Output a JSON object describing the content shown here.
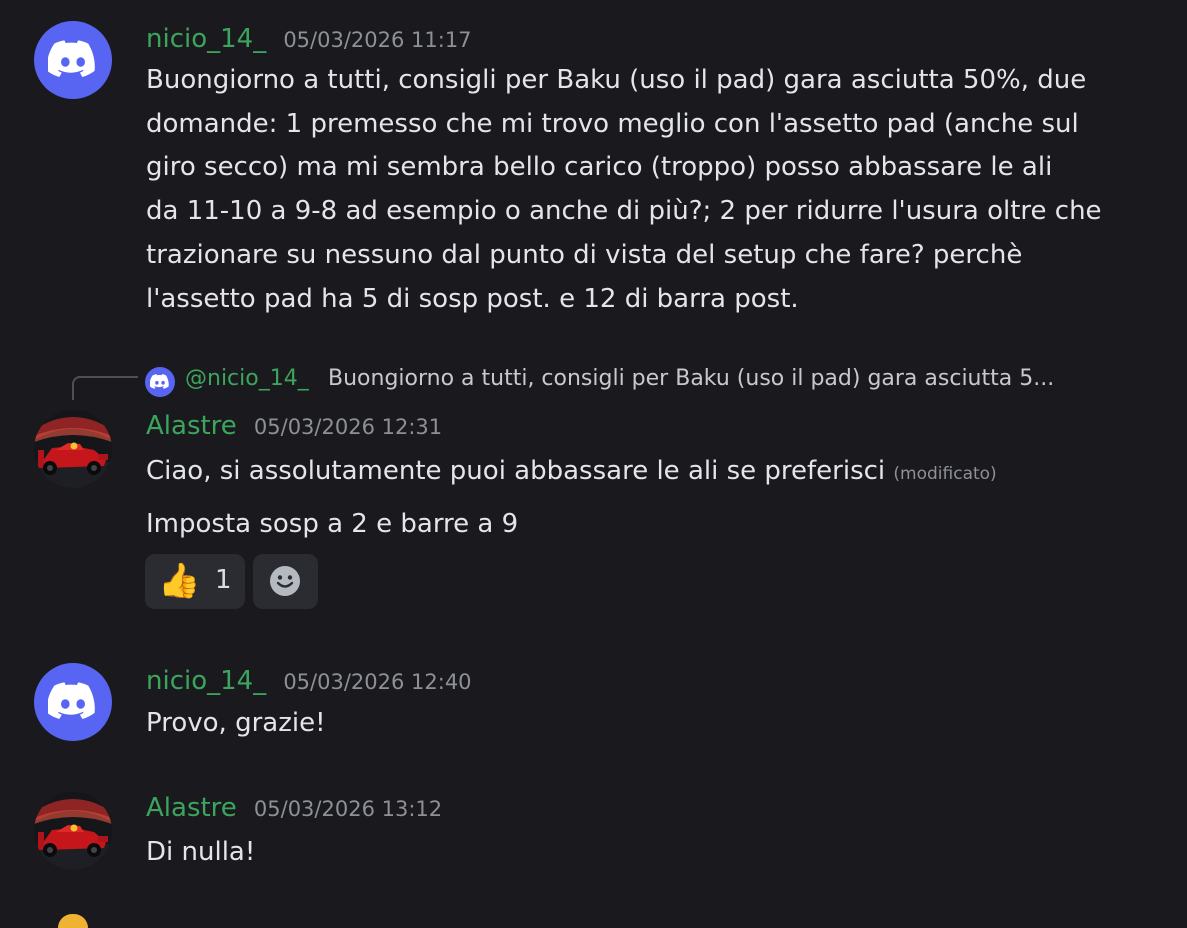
{
  "messages": [
    {
      "username": "nicio_14_",
      "timestamp": "05/03/2026 11:17",
      "avatar_icon": "discord-logo-icon",
      "lines": [
        "Buongiorno a tutti, consigli per Baku (uso il pad) gara asciutta 50%, due",
        "domande: 1 premesso che mi trovo meglio con l'assetto pad (anche sul",
        "giro secco) ma mi sembra bello carico (troppo) posso abbassare le ali",
        "da 11-10 a 9-8 ad esempio o anche di più?; 2 per ridurre l'usura oltre che",
        "trazionare su nessuno dal punto di vista del setup che fare? perchè",
        "l'assetto pad ha 5 di sosp post. e 12 di barra post."
      ]
    },
    {
      "username": "Alastre",
      "timestamp": "05/03/2026 12:31",
      "avatar_icon": "red-f1-car-avatar",
      "reply": {
        "username": "@nicio_14_",
        "text": "Buongiorno a tutti, consigli per Baku (uso il pad) gara asciutta 5..."
      },
      "line_1": "Ciao, si assolutamente puoi abbassare le ali se preferisci",
      "edited_label": "(modificato)",
      "line_2": "Imposta sosp a 2 e  barre a 9",
      "reactions": [
        {
          "emoji": "👍",
          "icon": "thumbs-up-icon",
          "count": "1"
        }
      ],
      "add_reaction_icon": "add-reaction-smiley-icon"
    },
    {
      "username": "nicio_14_",
      "timestamp": "05/03/2026 12:40",
      "avatar_icon": "discord-logo-icon",
      "text": "Provo, grazie!"
    },
    {
      "username": "Alastre",
      "timestamp": "05/03/2026 13:12",
      "avatar_icon": "red-f1-car-avatar",
      "text": "Di nulla!"
    }
  ],
  "colors": {
    "background": "#1a1a1e",
    "username": "#3ba55d",
    "timestamp": "#8d9096",
    "text": "#e3e5e8",
    "blurple": "#5865f2",
    "reaction_bg": "#2b2c31"
  }
}
